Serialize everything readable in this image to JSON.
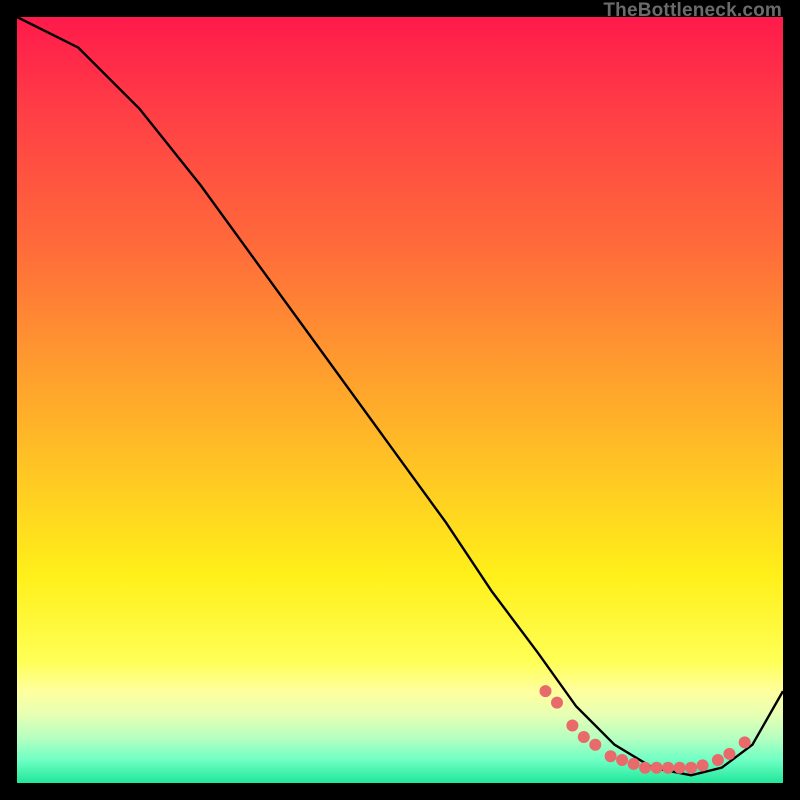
{
  "watermark": {
    "text": "TheBottleneck.com"
  },
  "chart_data": {
    "type": "line",
    "title": "",
    "xlabel": "",
    "ylabel": "",
    "xlim": [
      0,
      100
    ],
    "ylim": [
      0,
      100
    ],
    "series": [
      {
        "name": "curve",
        "x": [
          0,
          8,
          16,
          24,
          32,
          40,
          48,
          56,
          62,
          68,
          73,
          78,
          83,
          88,
          92,
          96,
          100
        ],
        "values": [
          100,
          96,
          88,
          78,
          67,
          56,
          45,
          34,
          25,
          17,
          10,
          5,
          2,
          1,
          2,
          5,
          12
        ]
      }
    ],
    "markers": [
      {
        "x": 69.0,
        "y": 12.0
      },
      {
        "x": 70.5,
        "y": 10.5
      },
      {
        "x": 72.5,
        "y": 7.5
      },
      {
        "x": 74.0,
        "y": 6.0
      },
      {
        "x": 75.5,
        "y": 5.0
      },
      {
        "x": 77.5,
        "y": 3.5
      },
      {
        "x": 79.0,
        "y": 3.0
      },
      {
        "x": 80.5,
        "y": 2.5
      },
      {
        "x": 82.0,
        "y": 2.0
      },
      {
        "x": 83.5,
        "y": 2.0
      },
      {
        "x": 85.0,
        "y": 2.0
      },
      {
        "x": 86.5,
        "y": 2.0
      },
      {
        "x": 88.0,
        "y": 2.0
      },
      {
        "x": 89.5,
        "y": 2.3
      },
      {
        "x": 91.5,
        "y": 3.0
      },
      {
        "x": 93.0,
        "y": 3.8
      },
      {
        "x": 95.0,
        "y": 5.3
      }
    ],
    "colors": {
      "curve": "#000000",
      "marker_fill": "#e86a6a",
      "marker_stroke": "#e86a6a"
    }
  }
}
